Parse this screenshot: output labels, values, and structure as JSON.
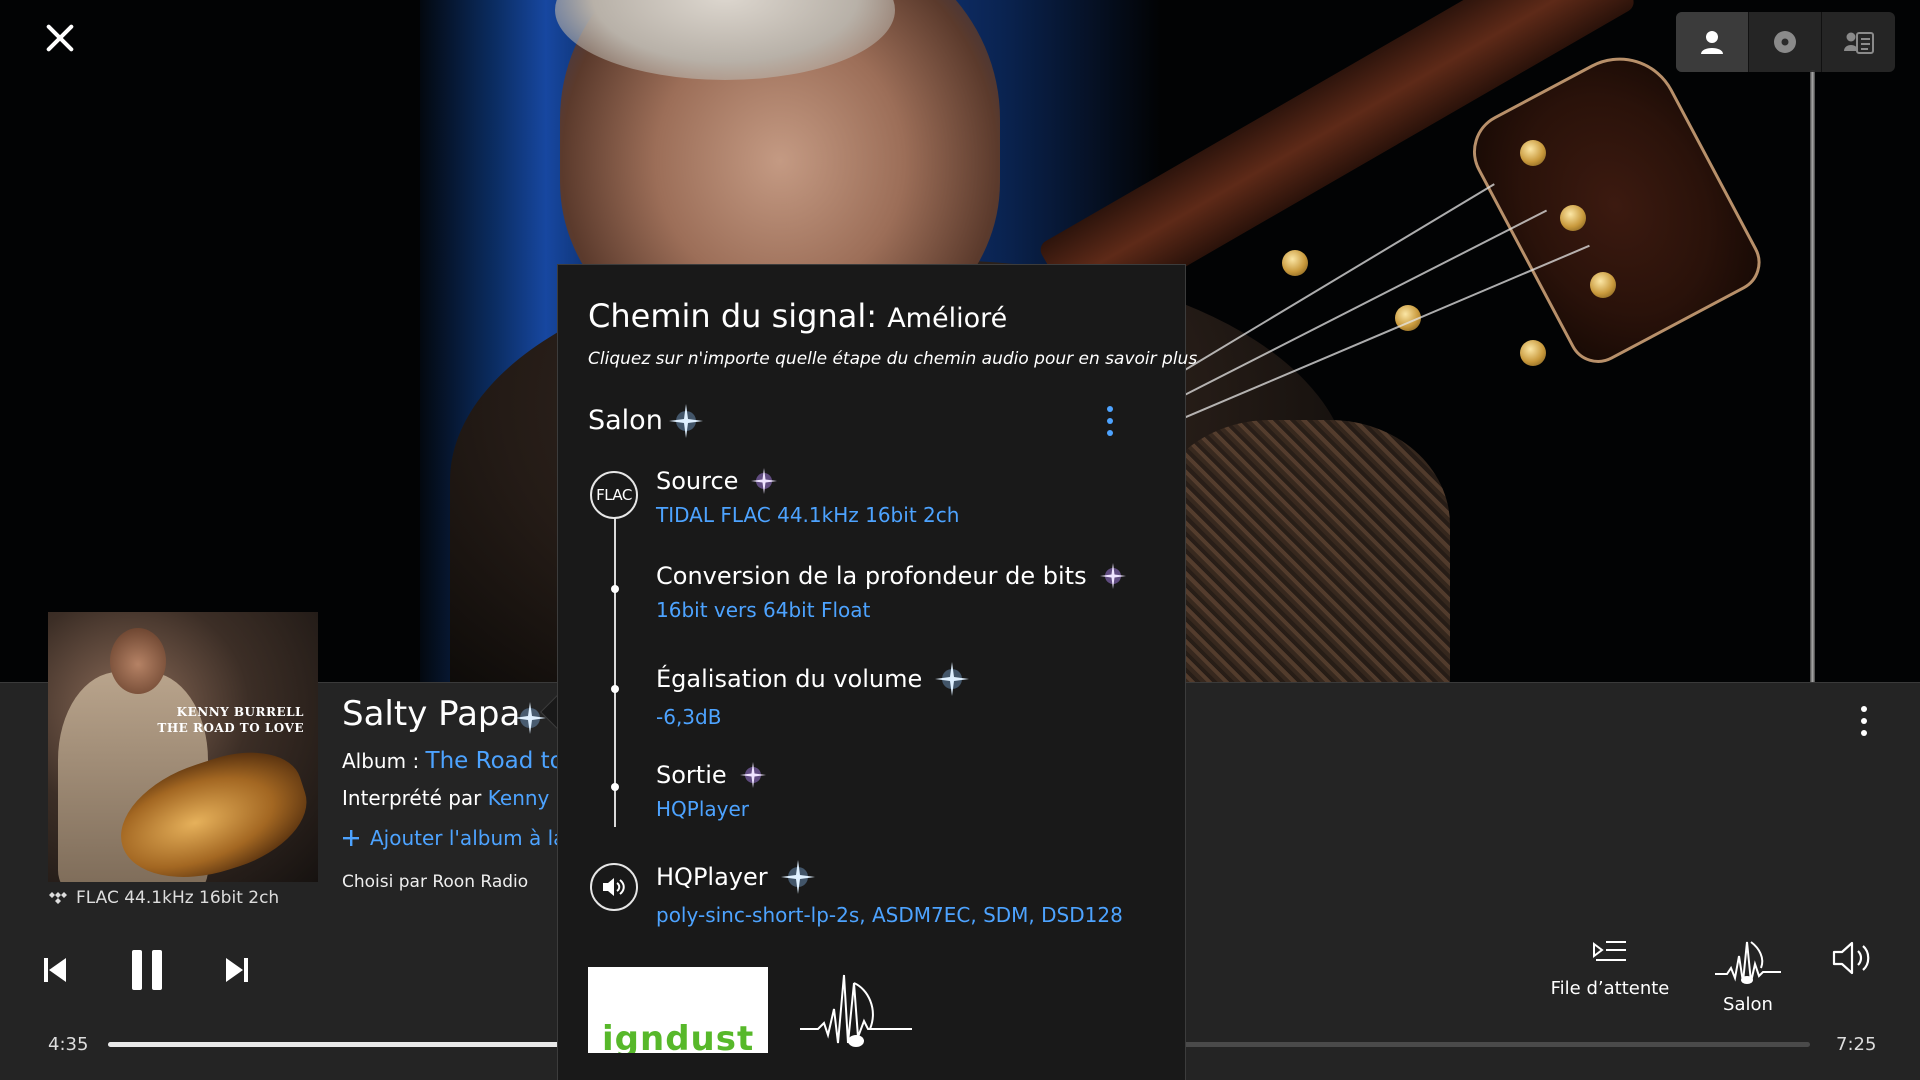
{
  "colors": {
    "link": "#4da3ff",
    "panel_bg": "#191919",
    "bar_bg": "#242424",
    "star_blue": "#8fc7ff",
    "star_purple": "#b78bff"
  },
  "top": {
    "close_icon": "close-icon",
    "views": [
      {
        "icon": "person-icon"
      },
      {
        "icon": "disc-icon"
      },
      {
        "icon": "lyrics-icon"
      }
    ]
  },
  "now_playing": {
    "album_art_text": {
      "artist": "KENNY BURRELL",
      "album": "THE ROAD TO LOVE"
    },
    "format": "FLAC 44.1kHz 16bit 2ch",
    "title": "Salty Papa",
    "album_label": "Album :",
    "album_name": "The Road to",
    "artist_label": "Interprété par",
    "artist_name": "Kenny B",
    "add_album": "Ajouter l'album à la",
    "chosen_by": "Choisi par Roon Radio"
  },
  "transport": {
    "elapsed": "4:35",
    "total": "7:25",
    "progress_fraction": 0.615
  },
  "tools": {
    "queue_label": "File d’attente",
    "zone_label": "Salon"
  },
  "signal_path": {
    "title": "Chemin du signal:",
    "quality": "Amélioré",
    "hint": "Cliquez sur n'importe quelle étape du chemin audio pour en savoir plus",
    "zone": "Salon",
    "source_badge": "FLAC",
    "steps": [
      {
        "title": "Source",
        "detail": "TIDAL FLAC 44.1kHz 16bit 2ch",
        "star": "purple"
      },
      {
        "title": "Conversion de la profondeur de bits",
        "detail": "16bit vers 64bit Float",
        "star": "purple"
      },
      {
        "title": "Égalisation du volume",
        "detail": "-6,3dB",
        "star": "blue"
      },
      {
        "title": "Sortie",
        "detail": "HQPlayer",
        "star": "purple"
      },
      {
        "title": "HQPlayer",
        "detail": "poly-sinc-short-lp-2s, ASDM7EC, SDM, DSD128",
        "star": "blue"
      }
    ],
    "logo_text": "igndust"
  }
}
